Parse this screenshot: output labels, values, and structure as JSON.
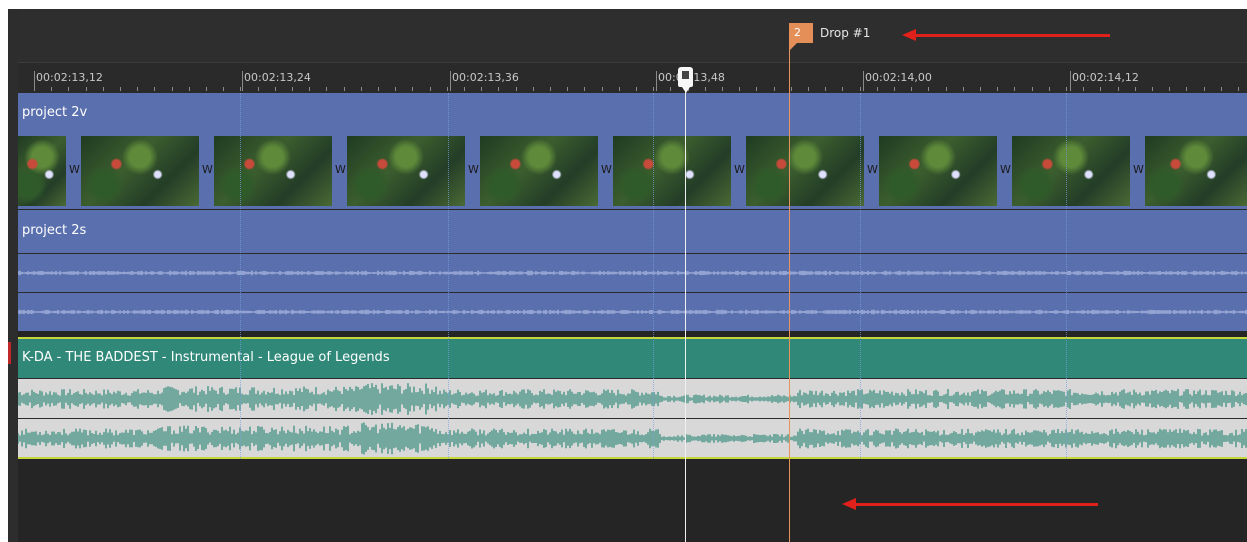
{
  "ruler": {
    "ticks": [
      "00:02:13,12",
      "00:02:13,24",
      "00:02:13,36",
      "00:02:13,48",
      "00:02:14,00",
      "00:02:14,12"
    ]
  },
  "marker": {
    "number": "2",
    "label": "Drop #1"
  },
  "tracks": {
    "video_name": "project 2v",
    "audio_name": "project 2s",
    "music_name": "K-DA - THE BADDEST - Instrumental - League of Legends"
  },
  "thumbnail_gap_letter": "W",
  "colors": {
    "video_track": "#5a6fae",
    "music_track": "#2f8878",
    "marker": "#e58f58",
    "annotation_arrow": "#e0201a"
  },
  "icons": [
    "playhead-handle-icon",
    "marker-flag-icon",
    "arrow-left-icon"
  ]
}
